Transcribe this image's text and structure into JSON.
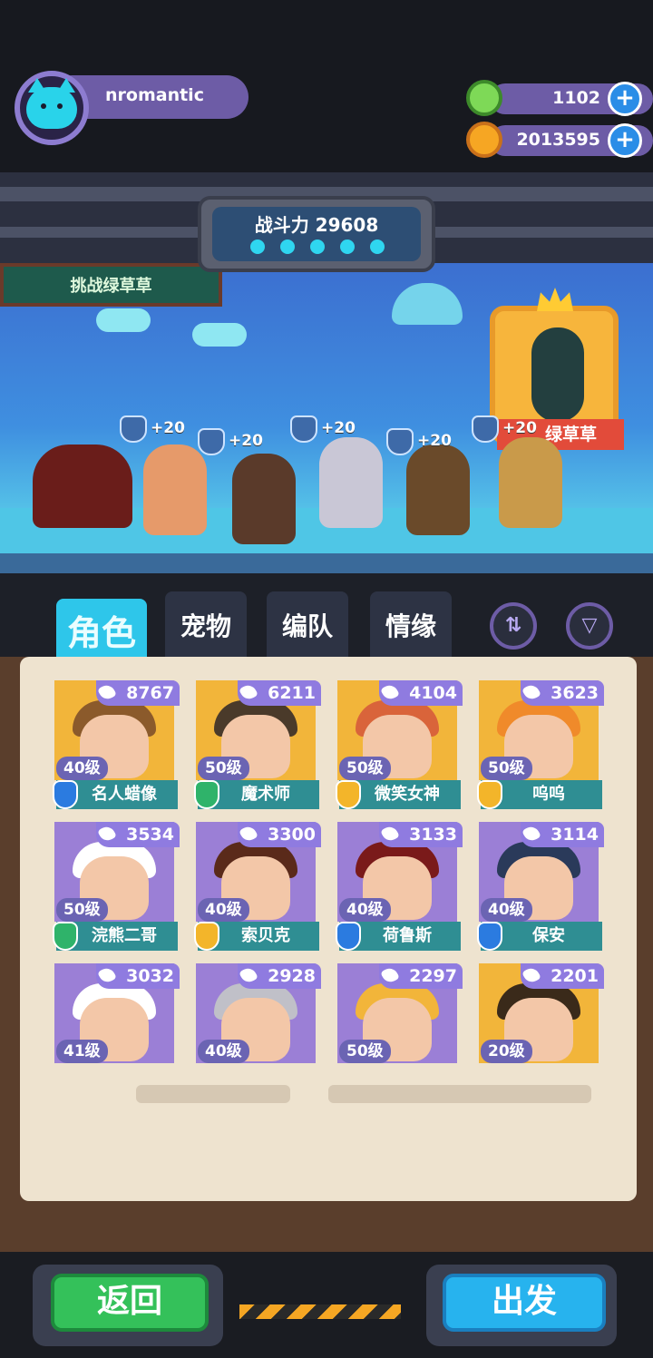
{
  "player": {
    "name": "nromantic"
  },
  "currency": {
    "gems": "1102",
    "coins": "2013595",
    "gem_color": "#7ed957",
    "coin_color": "#f6a623"
  },
  "stage": {
    "challenge_label": "挑战绿草草",
    "power_label": "战斗力 29608",
    "boss_ribbon": "绿草草",
    "bonuses": [
      "+20",
      "+20",
      "+20",
      "+20",
      "+20"
    ]
  },
  "tabs": [
    "角色",
    "宠物",
    "编队",
    "情缘"
  ],
  "active_tab": "角色",
  "characters": [
    {
      "power": "8767",
      "level": "40级",
      "name": "名人蜡像",
      "class_color": "#2b7be0",
      "bg": "#f2b53a",
      "hair": "#8b5a2b"
    },
    {
      "power": "6211",
      "level": "50级",
      "name": "魔术师",
      "class_color": "#2fb36a",
      "bg": "#f2b53a",
      "hair": "#4a3a2a"
    },
    {
      "power": "4104",
      "level": "50级",
      "name": "微笑女神",
      "class_color": "#f3b52a",
      "bg": "#f2b53a",
      "hair": "#d9643a"
    },
    {
      "power": "3623",
      "level": "50级",
      "name": "呜呜",
      "class_color": "#f3b52a",
      "bg": "#f2b53a",
      "hair": "#f08a2a"
    },
    {
      "power": "3534",
      "level": "50级",
      "name": "浣熊二哥",
      "class_color": "#2fb36a",
      "bg": "#9b7fd6",
      "hair": "#ffffff"
    },
    {
      "power": "3300",
      "level": "40级",
      "name": "索贝克",
      "class_color": "#f3b52a",
      "bg": "#9b7fd6",
      "hair": "#5a2a1a"
    },
    {
      "power": "3133",
      "level": "40级",
      "name": "荷鲁斯",
      "class_color": "#2b7be0",
      "bg": "#9b7fd6",
      "hair": "#7a1a1a"
    },
    {
      "power": "3114",
      "level": "40级",
      "name": "保安",
      "class_color": "#2b7be0",
      "bg": "#9b7fd6",
      "hair": "#2a3a5a"
    },
    {
      "power": "3032",
      "level": "41级",
      "name": "",
      "class_color": "",
      "bg": "#9b7fd6",
      "hair": "#ffffff"
    },
    {
      "power": "2928",
      "level": "40级",
      "name": "",
      "class_color": "",
      "bg": "#9b7fd6",
      "hair": "#c0c0c8"
    },
    {
      "power": "2297",
      "level": "50级",
      "name": "",
      "class_color": "",
      "bg": "#9b7fd6",
      "hair": "#f2b53a"
    },
    {
      "power": "2201",
      "level": "20级",
      "name": "",
      "class_color": "",
      "bg": "#f2b53a",
      "hair": "#3a2a1a"
    }
  ],
  "buttons": {
    "back": "返回",
    "go": "出发"
  }
}
